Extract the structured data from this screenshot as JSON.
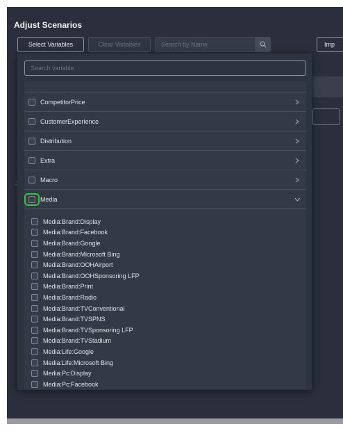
{
  "header": {
    "title": "Adjust Scenarios",
    "select_variables_label": "Select Variables",
    "clear_variables_label": "Clear Variables",
    "search_placeholder": "Search by Name",
    "import_label": "Imp"
  },
  "panel": {
    "search_placeholder": "Search variable",
    "categories": [
      {
        "label": "CompetitorPrice",
        "expanded": false
      },
      {
        "label": "CustomerExperience",
        "expanded": false
      },
      {
        "label": "Distribution",
        "expanded": false
      },
      {
        "label": "Extra",
        "expanded": false
      },
      {
        "label": "Macro",
        "expanded": false
      },
      {
        "label": "Media",
        "expanded": true
      }
    ],
    "media_items": [
      "Media:Brand:Display",
      "Media:Brand:Facebook",
      "Media:Brand:Google",
      "Media:Brand:Microsoft Bing",
      "Media:Brand:OOHAirport",
      "Media:Brand:OOHSponsoring LFP",
      "Media:Brand:Print",
      "Media:Brand:Radio",
      "Media:Brand:TVConventional",
      "Media:Brand:TVSPNS",
      "Media:Brand:TVSponsoring LFP",
      "Media:Brand:TVStadium",
      "Media:Life:Google",
      "Media:Life:Microsoft Bing",
      "Media:Pc:Display",
      "Media:Pc:Facebook"
    ]
  },
  "colors": {
    "background": "#2a2f3b",
    "panel": "#2e3340",
    "list": "#343946",
    "focus": "#3fbf4e"
  },
  "icons": {
    "search": "search-icon",
    "collapsed": "chevron-right-icon",
    "expanded": "chevron-down-icon"
  }
}
